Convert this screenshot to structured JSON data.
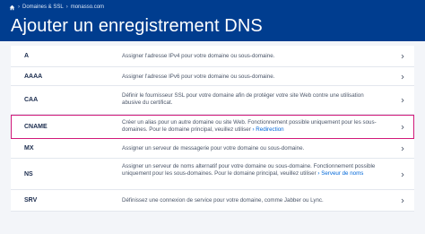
{
  "breadcrumb": {
    "items": [
      "Domaines & SSL",
      "monasso.com"
    ],
    "sep": "›"
  },
  "title": "Ajouter un enregistrement DNS",
  "records": [
    {
      "type": "A",
      "text": "Assigner l'adresse IPv4 pour votre domaine ou sous-domaine."
    },
    {
      "type": "AAAA",
      "text": "Assigner l'adresse IPv6 pour votre domaine ou sous-domaine."
    },
    {
      "type": "CAA",
      "text": "Définir le fournisseur SSL pour votre domaine afin de protéger votre site Web contre une utilisation abusive du certificat."
    },
    {
      "type": "CNAME",
      "text": "Créer un alias pour un autre domaine ou site Web. Fonctionnement possible uniquement pour les sous-domaines. Pour le domaine principal, veuillez utiliser",
      "link": "Redirection",
      "highlighted": true
    },
    {
      "type": "MX",
      "text": "Assigner un serveur de messagerie pour votre domaine ou sous-domaine."
    },
    {
      "type": "NS",
      "text": "Assigner un serveur de noms alternatif pour votre domaine ou sous-domaine. Fonctionnement possible uniquement pour les sous-domaines. Pour le domaine principal, veuillez utiliser",
      "link": "Serveur de noms"
    },
    {
      "type": "SRV",
      "text": "Définissez une connexion de service pour votre domaine, comme Jabber ou Lync."
    }
  ],
  "link_arrow": "›",
  "colors": {
    "header": "#003d8f",
    "highlight": "#d1197a",
    "link": "#0067d8"
  }
}
